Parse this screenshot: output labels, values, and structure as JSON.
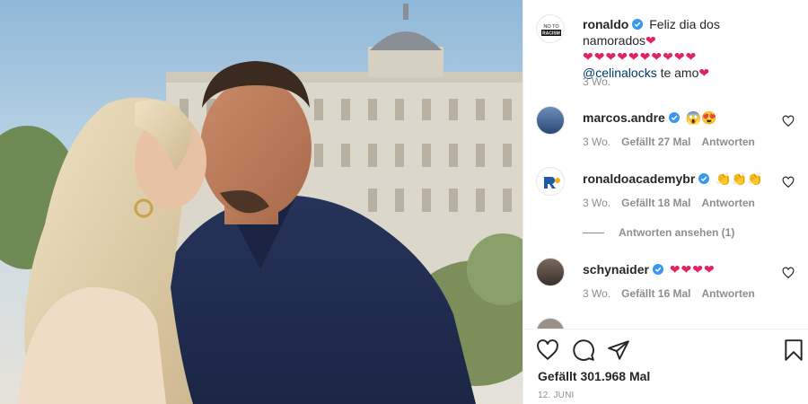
{
  "post": {
    "caption_user": "ronaldo",
    "caption_text": "Feliz dia dos namorados",
    "caption_hearts_line1": "❤",
    "caption_hearts_line2": "❤❤❤❤❤❤❤❤❤❤",
    "caption_mention": "@celinalocks",
    "caption_end": " te amo",
    "caption_end_heart": "❤",
    "caption_time": "3 Wo.",
    "likes": "Gefällt 301.968 Mal",
    "date": "12. JUNI",
    "owner_avatar_text_top": "NO TO",
    "owner_avatar_text_bottom": "RACISM"
  },
  "comments": [
    {
      "user": "marcos.andre",
      "text": "😱😍",
      "time": "3 Wo.",
      "likes": "Gefällt 27 Mal",
      "reply": "Antworten"
    },
    {
      "user": "ronaldoacademybr",
      "text": "👏👏👏",
      "time": "3 Wo.",
      "likes": "Gefällt 18 Mal",
      "reply": "Antworten"
    },
    {
      "user": "schynaider",
      "text": "❤❤❤❤",
      "time": "3 Wo.",
      "likes": "Gefällt 16 Mal",
      "reply": "Antworten"
    }
  ],
  "view_replies": "Antworten ansehen (1)",
  "colors": {
    "verified": "#3897f0",
    "heart": "#e0245e",
    "muted": "#8e8e8e"
  },
  "icons": [
    "heart-icon",
    "comment-icon",
    "share-icon",
    "bookmark-icon",
    "verified-icon",
    "like-comment-icon"
  ]
}
